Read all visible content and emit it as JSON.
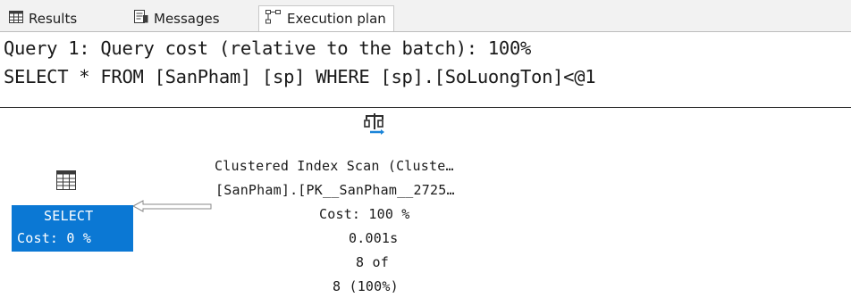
{
  "tabs": [
    {
      "label": "Results",
      "icon": "grid-icon"
    },
    {
      "label": "Messages",
      "icon": "messages-icon"
    },
    {
      "label": "Execution plan",
      "icon": "execution-plan-icon",
      "active": true
    }
  ],
  "header": {
    "line1": "Query 1: Query cost (relative to the batch): 100%",
    "line2": "SELECT * FROM [SanPham] [sp] WHERE [sp].[SoLuongTon]<@1"
  },
  "plan": {
    "select_node": {
      "title": "SELECT",
      "cost": "Cost: 0 %",
      "icon": "result-table-icon"
    },
    "scan_node": {
      "icon": "clustered-index-scan-icon",
      "line1": "Clustered Index Scan (Cluste…",
      "line2": "[SanPham].[PK__SanPham__2725…",
      "cost": "Cost: 100 %",
      "time": "0.001s",
      "rows_line1": "8 of",
      "rows_line2": "8 (100%)"
    }
  },
  "colors": {
    "selected_node": "#0b78d4",
    "tabbar_bg": "#f2f2f2"
  }
}
